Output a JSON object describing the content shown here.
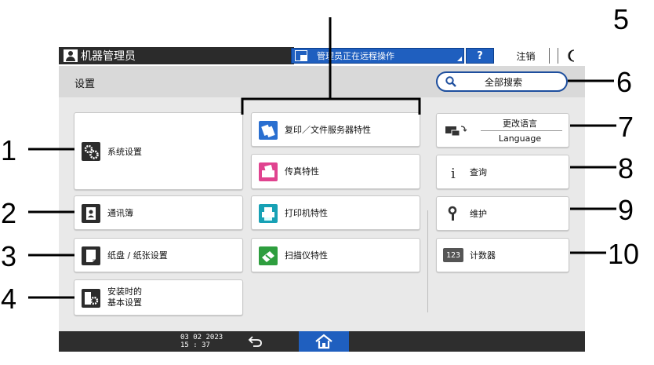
{
  "titlebar": {
    "user_name": "机器管理员",
    "remote_status": "管理员正在远程操作",
    "help_label": "?",
    "logout_label": "注销",
    "sleep_icon": "moon-icon"
  },
  "header": {
    "title": "设置",
    "search_label": "全部搜索"
  },
  "tiles": {
    "system": "系统设置",
    "address_book": "通讯簿",
    "tray_paper": "纸盘 / 纸张设置",
    "install_basic_line1": "安装时的",
    "install_basic_line2": "基本设置",
    "copier": "复印／文件服务器特性",
    "fax": "传真特性",
    "printer": "打印机特性",
    "scanner": "扫描仪特性",
    "language_line1": "更改语言",
    "language_line2": "Language",
    "inquiry": "查询",
    "maintenance": "维护",
    "counter": "计数器",
    "counter_badge": "123"
  },
  "statusbar": {
    "date": "03 02 2023",
    "time": "15 : 37"
  },
  "callouts": [
    "1",
    "2",
    "3",
    "4",
    "5",
    "6",
    "7",
    "8",
    "9",
    "10"
  ],
  "colors": {
    "accent_blue": "#1f5fbf",
    "fax_pink": "#e0438f",
    "scanner_green": "#2e9e3e",
    "printer_teal": "#17a1b5"
  }
}
